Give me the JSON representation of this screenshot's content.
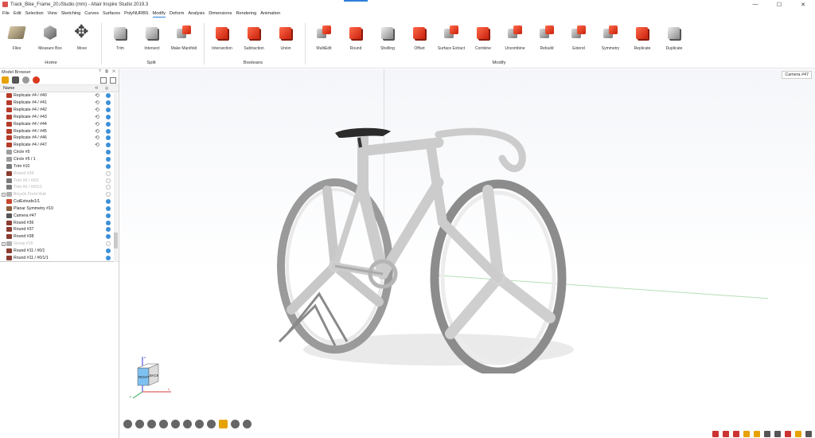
{
  "window": {
    "title": "Track_Bike_Frame_20.iStudio (mm) - Altair Inspire Studio 2019.3",
    "controls": [
      "—",
      "☐",
      "✕"
    ]
  },
  "menu": [
    "File",
    "Edit",
    "Selection",
    "View",
    "Sketching",
    "Curves",
    "Surfaces",
    "PolyNURBS",
    "Modify",
    "Deform",
    "Analysis",
    "Dimensions",
    "Rendering",
    "Animation"
  ],
  "active_menu": "Modify",
  "ribbon": {
    "home": {
      "label": "Home",
      "tools": [
        "Files",
        "Measure Box",
        "Move"
      ]
    },
    "split": {
      "label": "Split",
      "tools": [
        "Trim",
        "Intersect",
        "Make Manifold"
      ]
    },
    "booleans": {
      "label": "Booleans",
      "tools": [
        "Intersection",
        "Subtraction",
        "Union"
      ]
    },
    "modify": {
      "label": "Modify",
      "tools": [
        "MultiEdit",
        "Round",
        "Shelling",
        "Offset",
        "Surface Extract",
        "Combine",
        "Uncombine",
        "Rebuild",
        "Extend",
        "Symmetry",
        "Replicate",
        "Duplicate"
      ]
    }
  },
  "browser": {
    "title": "Model Browser",
    "header_controls": "? ⧉ ✕",
    "column_name": "Name",
    "rows": [
      {
        "label": "Replicate #4 / #40",
        "indent": 1,
        "icon": "replicate",
        "link": true,
        "visible": true
      },
      {
        "label": "Replicate #4 / #41",
        "indent": 1,
        "icon": "replicate",
        "link": true,
        "visible": true
      },
      {
        "label": "Replicate #4 / #42",
        "indent": 1,
        "icon": "replicate",
        "link": true,
        "visible": true
      },
      {
        "label": "Replicate #4 / #43",
        "indent": 1,
        "icon": "replicate",
        "link": true,
        "visible": true
      },
      {
        "label": "Replicate #4 / #44",
        "indent": 1,
        "icon": "replicate",
        "link": true,
        "visible": true
      },
      {
        "label": "Replicate #4 / #45",
        "indent": 1,
        "icon": "replicate",
        "link": true,
        "visible": true
      },
      {
        "label": "Replicate #4 / #46",
        "indent": 1,
        "icon": "replicate",
        "link": true,
        "visible": true
      },
      {
        "label": "Replicate #4 / #47",
        "indent": 1,
        "icon": "replicate",
        "link": true,
        "visible": true
      },
      {
        "label": "Circle #5",
        "indent": 1,
        "icon": "circle",
        "link": false,
        "visible": true
      },
      {
        "label": "Circle #5 / 1",
        "indent": 1,
        "icon": "circle",
        "link": false,
        "visible": true
      },
      {
        "label": "Trim #10",
        "indent": 1,
        "icon": "trim",
        "link": false,
        "visible": true
      },
      {
        "label": "Round #34",
        "indent": 1,
        "icon": "round",
        "link": false,
        "visible": false,
        "disabled": true
      },
      {
        "label": "Trim #6 / #0/1",
        "indent": 1,
        "icon": "trim",
        "link": false,
        "visible": false,
        "disabled": true
      },
      {
        "label": "Trim #6 / #0/1/1",
        "indent": 1,
        "icon": "trim",
        "link": false,
        "visible": false,
        "disabled": true
      },
      {
        "label": "Bicycle Front Hub",
        "indent": 0,
        "icon": "group",
        "link": false,
        "visible": false,
        "disabled": true,
        "expander": true
      },
      {
        "label": "CutExtrude1/1",
        "indent": 1,
        "icon": "extrude",
        "link": false,
        "visible": true
      },
      {
        "label": "Planar Symmetry #10",
        "indent": 1,
        "icon": "symmetry",
        "link": false,
        "visible": true
      },
      {
        "label": "Camera #47",
        "indent": 1,
        "icon": "camera",
        "link": false,
        "visible": true
      },
      {
        "label": "Round #36",
        "indent": 1,
        "icon": "round",
        "link": false,
        "visible": true
      },
      {
        "label": "Round #37",
        "indent": 1,
        "icon": "round",
        "link": false,
        "visible": true
      },
      {
        "label": "Round #38",
        "indent": 1,
        "icon": "round",
        "link": false,
        "visible": true
      },
      {
        "label": "Group #16",
        "indent": 0,
        "icon": "group",
        "link": false,
        "visible": false,
        "disabled": true,
        "expander": true
      },
      {
        "label": "Round #11 / #0/1",
        "indent": 1,
        "icon": "round",
        "link": false,
        "visible": true
      },
      {
        "label": "Round #11 / #0/1/1",
        "indent": 1,
        "icon": "round",
        "link": false,
        "visible": true
      }
    ]
  },
  "viewport": {
    "camera_label": "Camera #47",
    "viewcube": {
      "right": "RIGHT",
      "back": "BACK",
      "axis_x": "x",
      "axis_y": "y",
      "axis_z": "z"
    }
  },
  "colors": {
    "accent": "#2f7fd8",
    "tool_red": "#e0391c",
    "check_blue": "#3c8fd8"
  }
}
